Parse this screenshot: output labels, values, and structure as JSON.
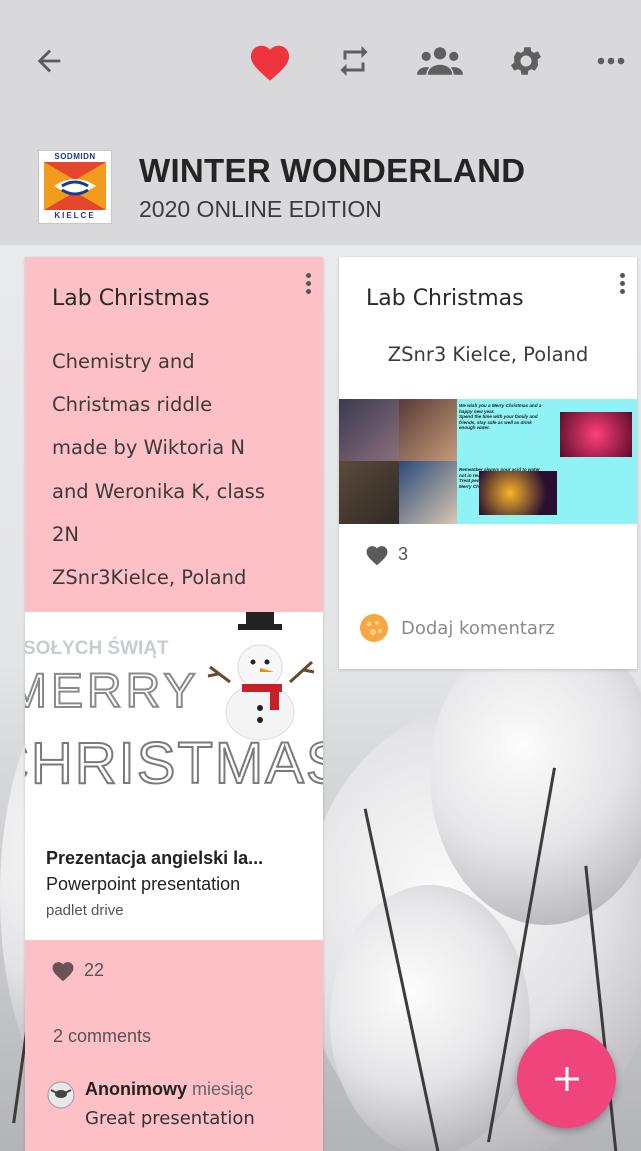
{
  "toolbar": {
    "icons": [
      "back-arrow-icon",
      "heart-icon",
      "remake-icon",
      "members-icon",
      "settings-icon",
      "more-icon"
    ],
    "accent_color": "#f0343f"
  },
  "header": {
    "logo": {
      "top_text": "SODMIDN",
      "bottom_text": "KIELCE"
    },
    "title": "WINTER WONDERLAND",
    "subtitle": "2020 ONLINE EDITION"
  },
  "posts": [
    {
      "title": "Lab Christmas",
      "body_lines": [
        "Chemistry and",
        "Christmas riddle",
        "made by Wiktoria N",
        "and Weronika K, class",
        "2N",
        "ZSnr3Kielce, Poland"
      ],
      "attachment": {
        "image_lines": [
          "SOŁYCH ŚWIĄT",
          "MERRY",
          "CHRISTMAS"
        ],
        "title": "Prezentacja angielski la...",
        "type": "Powerpoint presentation",
        "source": "padlet drive"
      },
      "likes": "22",
      "comments_count": "2 comments",
      "comment": {
        "author": "Anonimowy",
        "time": "miesiąc",
        "text": "Great presentation"
      },
      "background": "#fdc0c6"
    },
    {
      "title": "Lab Christmas",
      "subtitle": "ZSnr3 Kielce, Poland",
      "image_text": [
        "We wish you a Merry Christmas and a happy new year.",
        "Spend the time with your family and friends, stay safe as well as drink enough water.",
        "Remember always pour acid to water not in reverse!",
        "Treat people with kindness and again Merry Christmas!"
      ],
      "likes": "3",
      "add_comment_placeholder": "Dodaj komentarz",
      "background": "#ffffff"
    }
  ],
  "fab": {
    "icon": "plus-icon",
    "color": "#f0447c"
  }
}
